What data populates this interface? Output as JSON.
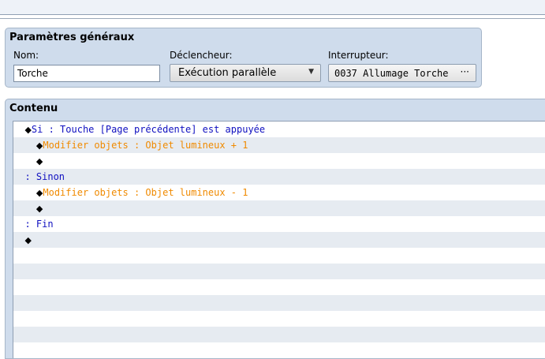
{
  "general": {
    "title": "Paramètres généraux",
    "name_label": "Nom:",
    "name_value": "Torche",
    "trigger_label": "Déclencheur:",
    "trigger_value": "Exécution parallèle",
    "switch_label": "Interrupteur:",
    "switch_value": "0037 Allumage Torche",
    "switch_button": "···"
  },
  "content": {
    "title": "Contenu",
    "rows": [
      {
        "indent": "  ",
        "marker": "◆",
        "text": "Si : Touche [Page précédente] est appuyée",
        "color": "blue"
      },
      {
        "indent": "    ",
        "marker": "◆",
        "text": "Modifier objets : Objet lumineux + 1",
        "color": "orange"
      },
      {
        "indent": "    ",
        "marker": "◆",
        "text": "",
        "color": "black"
      },
      {
        "indent": "  ",
        "marker": "",
        "text": ": Sinon",
        "color": "blue"
      },
      {
        "indent": "    ",
        "marker": "◆",
        "text": "Modifier objets : Objet lumineux - 1",
        "color": "orange"
      },
      {
        "indent": "    ",
        "marker": "◆",
        "text": "",
        "color": "black"
      },
      {
        "indent": "  ",
        "marker": "",
        "text": ": Fin",
        "color": "blue"
      },
      {
        "indent": "  ",
        "marker": "◆",
        "text": "",
        "color": "black"
      },
      {
        "indent": "",
        "marker": "",
        "text": "",
        "color": "black"
      },
      {
        "indent": "",
        "marker": "",
        "text": "",
        "color": "black"
      },
      {
        "indent": "",
        "marker": "",
        "text": "",
        "color": "black"
      },
      {
        "indent": "",
        "marker": "",
        "text": "",
        "color": "black"
      },
      {
        "indent": "",
        "marker": "",
        "text": "",
        "color": "black"
      },
      {
        "indent": "",
        "marker": "",
        "text": "",
        "color": "black"
      },
      {
        "indent": "",
        "marker": "",
        "text": "",
        "color": "black"
      }
    ]
  }
}
